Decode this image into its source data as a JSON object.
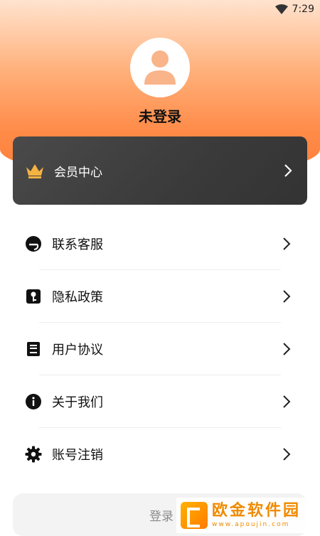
{
  "status_bar": {
    "time": "7:29"
  },
  "profile": {
    "login_status": "未登录"
  },
  "vip": {
    "label": "会员中心",
    "accent": "#f5b342"
  },
  "menu": {
    "items": [
      {
        "label": "联系客服",
        "icon": "headset-icon"
      },
      {
        "label": "隐私政策",
        "icon": "privacy-lock-icon"
      },
      {
        "label": "用户协议",
        "icon": "agreement-book-icon"
      },
      {
        "label": "关于我们",
        "icon": "info-icon"
      },
      {
        "label": "账号注销",
        "icon": "gear-icon"
      }
    ]
  },
  "login_button": {
    "label": "登录"
  },
  "watermark": {
    "cn": "欧金软件园",
    "en": "www.apoujin.com"
  },
  "colors": {
    "header_orange": "#ff7f3a",
    "vip_card": "#3a3a3a",
    "login_bg": "#f3f3f3"
  }
}
